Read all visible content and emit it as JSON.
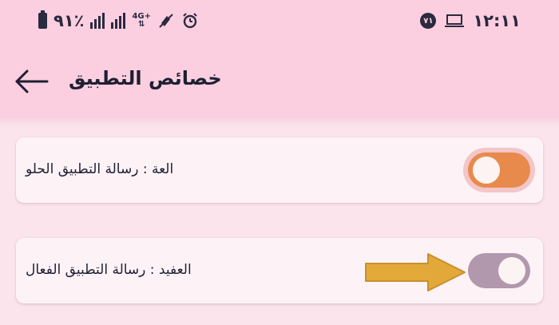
{
  "status_bar": {
    "left_text": "٩١٪",
    "network_label": "4G+",
    "time": "١٢:١١",
    "badge": "٧١"
  },
  "app_bar": {
    "title": "ﺧﺼﺎﺋﺺ ﺍﻟﺘﻄﺒﻴﻖ"
  },
  "settings": [
    {
      "label": "ﺍﻟﻌﺔ : ﺭﺳﺎﻟﺔ ﺍﻟﺘﻄﺒﻴﻖ ﺍﻟﺤﻠﻮ",
      "enabled": true
    },
    {
      "label": "ﺍﻟﻌﻔﻴﺪ : ﺭﺳﺎﻟﺔ ﺍﻟﺘﻄﺒﻴﻖ ﺍﻟﻔﻌﺎﻝ",
      "enabled": false
    }
  ],
  "colors": {
    "header_bg": "#fbcfdf",
    "page_bg": "#fbe4ec",
    "switch_on": "#e88a4c",
    "switch_off": "#b198ad",
    "arrow": "#e3a83a"
  }
}
